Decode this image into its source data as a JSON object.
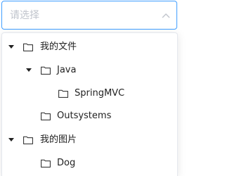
{
  "select": {
    "placeholder": "请选择",
    "arrow_icon": "chevron-up-icon",
    "border_color": "#409eff",
    "placeholder_color": "#c0c4cc"
  },
  "tree": {
    "nodes": [
      {
        "label": "我的文件",
        "level": 0,
        "has_children": true,
        "expanded": true,
        "icon": "folder-icon"
      },
      {
        "label": "Java",
        "level": 1,
        "has_children": true,
        "expanded": true,
        "icon": "folder-icon"
      },
      {
        "label": "SpringMVC",
        "level": 2,
        "has_children": false,
        "icon": "folder-icon"
      },
      {
        "label": "Outsystems",
        "level": 1,
        "has_children": false,
        "icon": "folder-icon"
      },
      {
        "label": "我的图片",
        "level": 0,
        "has_children": true,
        "expanded": true,
        "icon": "folder-icon"
      },
      {
        "label": "Dog",
        "level": 1,
        "has_children": false,
        "icon": "folder-icon"
      }
    ]
  }
}
